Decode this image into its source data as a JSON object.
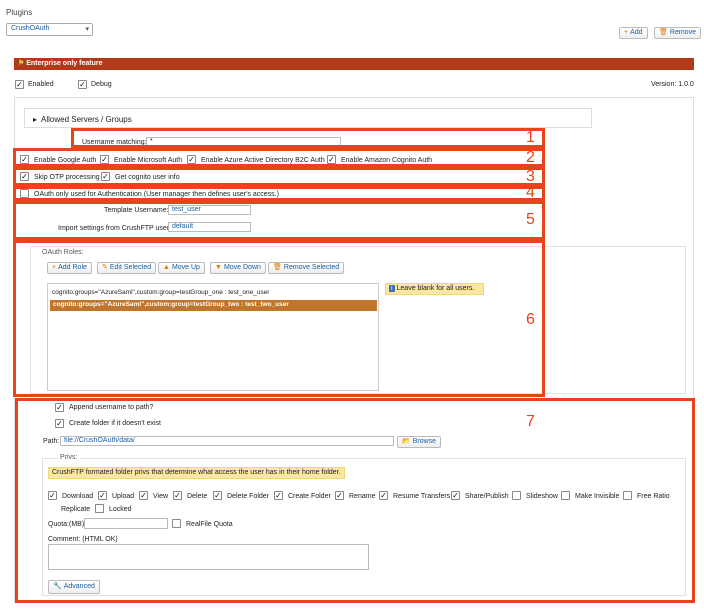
{
  "header": {
    "title": "Plugins",
    "plugin_select": "CrushOAuth",
    "add_label": "Add",
    "remove_label": "Remove"
  },
  "banner": {
    "text": "Enterprise only feature"
  },
  "top": {
    "enabled_label": "Enabled",
    "debug_label": "Debug",
    "version": "Version: 1.0.0"
  },
  "allowed": {
    "label": "Allowed Servers / Groups"
  },
  "username_matching": {
    "label": "Username matching:",
    "value": "*"
  },
  "auth": {
    "google": "Enable Google Auth",
    "microsoft": "Enable Microsoft Auth",
    "azure": "Enable Azure Active Directory B2C Auth",
    "cognito": "Enable Amazon Cognito Auth"
  },
  "otp": {
    "skip": "Skip OTP processing",
    "cognito_info": "Get cognito user info"
  },
  "oauth_only": {
    "label": "OAuth only used for Authentication (User manager then defines user's access.)"
  },
  "template": {
    "username_label": "Template Username:",
    "username_value": "test_user",
    "import_label": "Import settings from CrushFTP user:",
    "import_value": "default"
  },
  "roles": {
    "title": "OAuth Roles:",
    "add": "Add Role",
    "edit": "Edit Selected",
    "up": "Move Up",
    "down": "Move Down",
    "remove": "Remove Selected",
    "items": [
      "cognito:groups=\"AzureSaml\",custom:group=testGroup_one : test_one_user",
      "cognito:groups=\"AzureSaml\",custom:group=testGroup_two : test_two_user"
    ],
    "hint": "Leave blank for all users."
  },
  "paths": {
    "append": "Append username to path?",
    "create": "Create folder if it doesn't exist",
    "path_label": "Path:",
    "path_value": "file://CrushOAuth/data/",
    "browse": "Browse"
  },
  "privs": {
    "legend": "Privs:",
    "note": "CrushFTP formated folder privs that determine what access the user has in their home folder.",
    "items": [
      {
        "label": "Download",
        "checked": true
      },
      {
        "label": "Upload",
        "checked": true
      },
      {
        "label": "View",
        "checked": true
      },
      {
        "label": "Delete",
        "checked": true
      },
      {
        "label": "Delete Folder",
        "checked": true
      },
      {
        "label": "Create Folder",
        "checked": true
      },
      {
        "label": "Rename",
        "checked": true
      },
      {
        "label": "Resume Transfers",
        "checked": true
      },
      {
        "label": "Share/Publish",
        "checked": true
      },
      {
        "label": "Slideshow",
        "checked": false
      },
      {
        "label": "Make Invisible",
        "checked": false
      },
      {
        "label": "Free Ratio",
        "checked": false
      },
      {
        "label": "Replicate",
        "checked": true
      },
      {
        "label": "Locked",
        "checked": false
      }
    ],
    "quota_label": "Quota:(MB)",
    "realfile": "RealFile Quota",
    "comment_label": "Comment: (HTML OK)",
    "advanced": "Advanced"
  },
  "markers": [
    "1",
    "2",
    "3",
    "4",
    "5",
    "6",
    "7"
  ],
  "colors": {
    "banner": "#b03a1a",
    "highlight": "#c0752a",
    "callout": "#e8431b",
    "hint_bg": "#fbe7a1"
  }
}
